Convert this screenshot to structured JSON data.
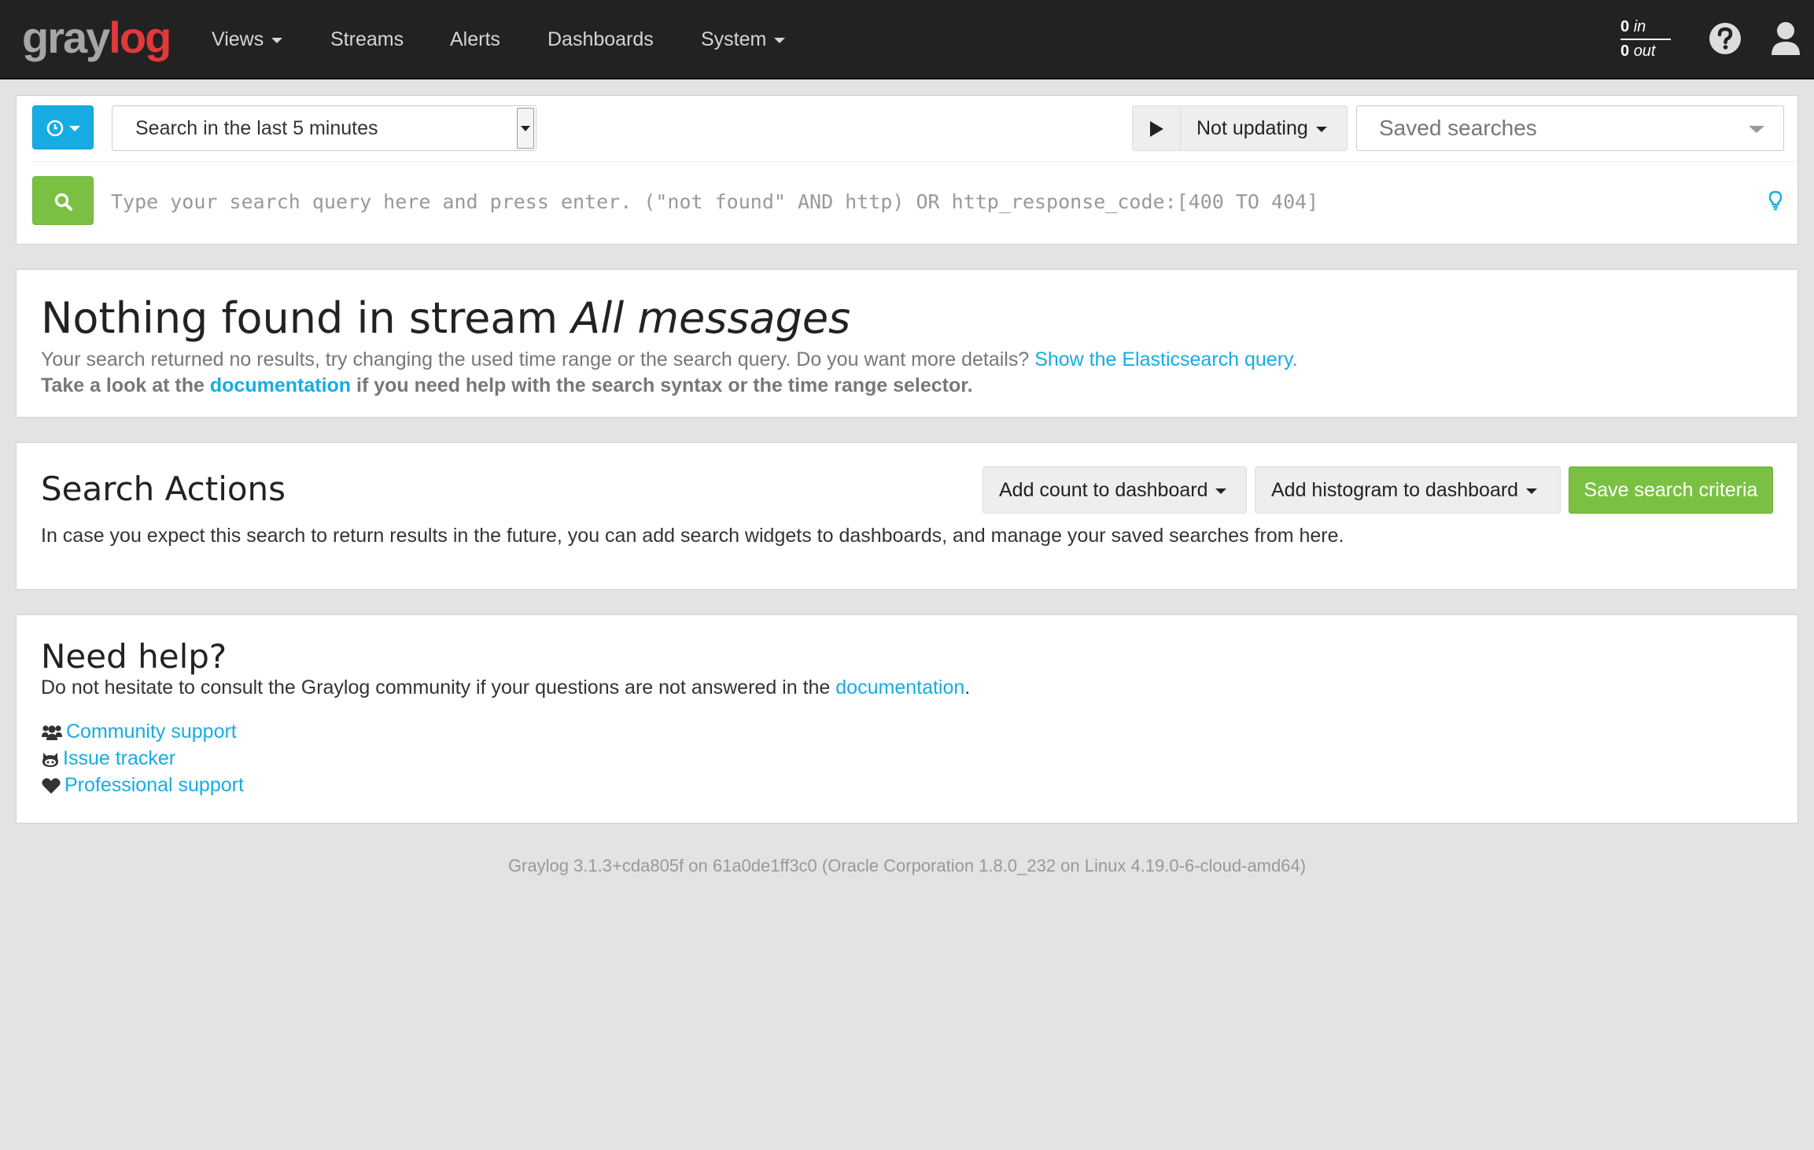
{
  "navbar": {
    "logo_gray": "gray",
    "logo_red": "log",
    "items": [
      {
        "label": "Views",
        "dropdown": true
      },
      {
        "label": "Streams",
        "dropdown": false
      },
      {
        "label": "Alerts",
        "dropdown": false
      },
      {
        "label": "Dashboards",
        "dropdown": false
      },
      {
        "label": "System",
        "dropdown": true
      }
    ],
    "throughput": {
      "in_count": "0",
      "in_label": "in",
      "out_count": "0",
      "out_label": "out"
    },
    "icons": [
      "help-icon",
      "user-icon"
    ]
  },
  "search_bar": {
    "time_range": "Search in the last 5 minutes",
    "update_label": "Not updating",
    "saved_searches_placeholder": "Saved searches",
    "query_placeholder": "Type your search query here and press enter. (\"not found\" AND http) OR http_response_code:[400 TO 404]"
  },
  "no_results": {
    "title_prefix": "Nothing found in stream ",
    "stream_name": "All messages",
    "line1_text": "Your search returned no results, try changing the used time range or the search query. Do you want more details? ",
    "line1_link": "Show the Elasticsearch query.",
    "line2_prefix": "Take a look at the ",
    "line2_link": "documentation",
    "line2_suffix": " if you need help with the search syntax or the time range selector."
  },
  "search_actions": {
    "title": "Search Actions",
    "add_count_label": "Add count to dashboard",
    "add_histogram_label": "Add histogram to dashboard",
    "save_label": "Save search criteria",
    "description": "In case you expect this search to return results in the future, you can add search widgets to dashboards, and manage your saved searches from here."
  },
  "help": {
    "title": "Need help?",
    "desc_prefix": "Do not hesitate to consult the Graylog community if your questions are not answered in the ",
    "desc_link": "documentation",
    "desc_suffix": ".",
    "links": [
      {
        "label": "Community support",
        "icon": "users-icon"
      },
      {
        "label": "Issue tracker",
        "icon": "github-icon"
      },
      {
        "label": "Professional support",
        "icon": "heart-icon"
      }
    ]
  },
  "footer": "Graylog 3.1.3+cda805f on 61a0de1ff3c0 (Oracle Corporation 1.8.0_232 on Linux 4.19.0-6-cloud-amd64)",
  "colors": {
    "navbar_bg": "#222222",
    "accent_blue": "#16ace3",
    "accent_green": "#7ac143",
    "logo_red": "#e3383c"
  }
}
